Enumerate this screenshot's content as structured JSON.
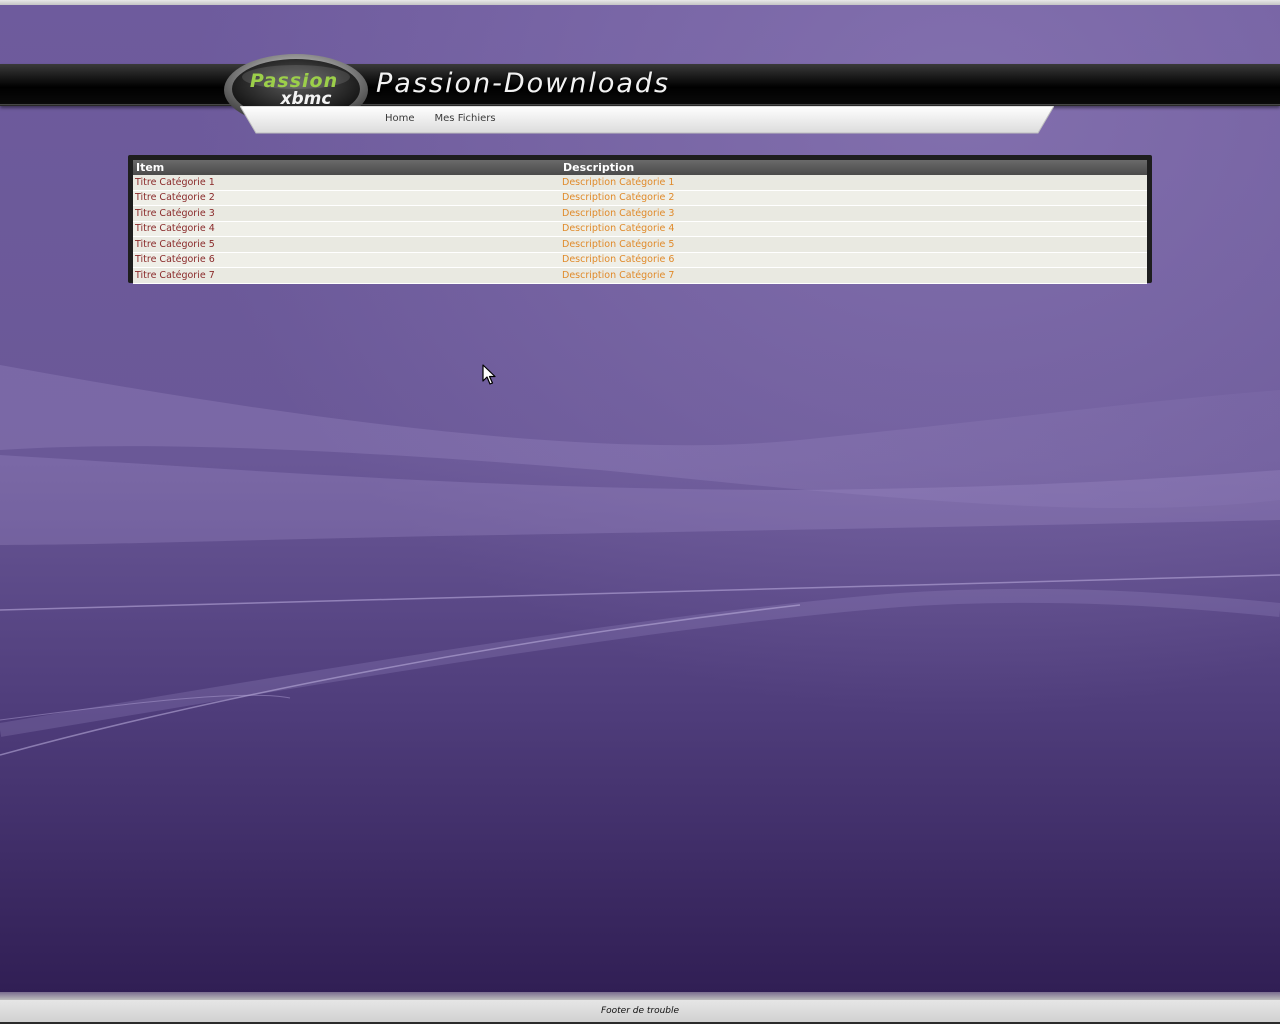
{
  "theme": {
    "accent": "#7a66a6",
    "background_top": "#6b5a99",
    "background_bottom": "#2e1e52",
    "item_link_color": "#8a2a2a",
    "description_link_color": "#e08a2a"
  },
  "header": {
    "site_title": "Passion-Downloads",
    "logo_text_top": "Passion",
    "logo_text_bottom": "xbmc"
  },
  "nav": {
    "items": [
      {
        "label": "Home"
      },
      {
        "label": "Mes Fichiers"
      }
    ]
  },
  "table": {
    "headers": [
      "Item",
      "Description"
    ],
    "rows": [
      {
        "item": "Titre Catégorie 1",
        "description": "Description Catégorie 1"
      },
      {
        "item": "Titre Catégorie 2",
        "description": "Description Catégorie 2"
      },
      {
        "item": "Titre Catégorie 3",
        "description": "Description Catégorie 3"
      },
      {
        "item": "Titre Catégorie 4",
        "description": "Description Catégorie 4"
      },
      {
        "item": "Titre Catégorie 5",
        "description": "Description Catégorie 5"
      },
      {
        "item": "Titre Catégorie 6",
        "description": "Description Catégorie 6"
      },
      {
        "item": "Titre Catégorie 7",
        "description": "Description Catégorie 7"
      }
    ]
  },
  "footer": {
    "text": "Footer de trouble"
  },
  "icons": {
    "cursor": "mouse-pointer-icon"
  }
}
